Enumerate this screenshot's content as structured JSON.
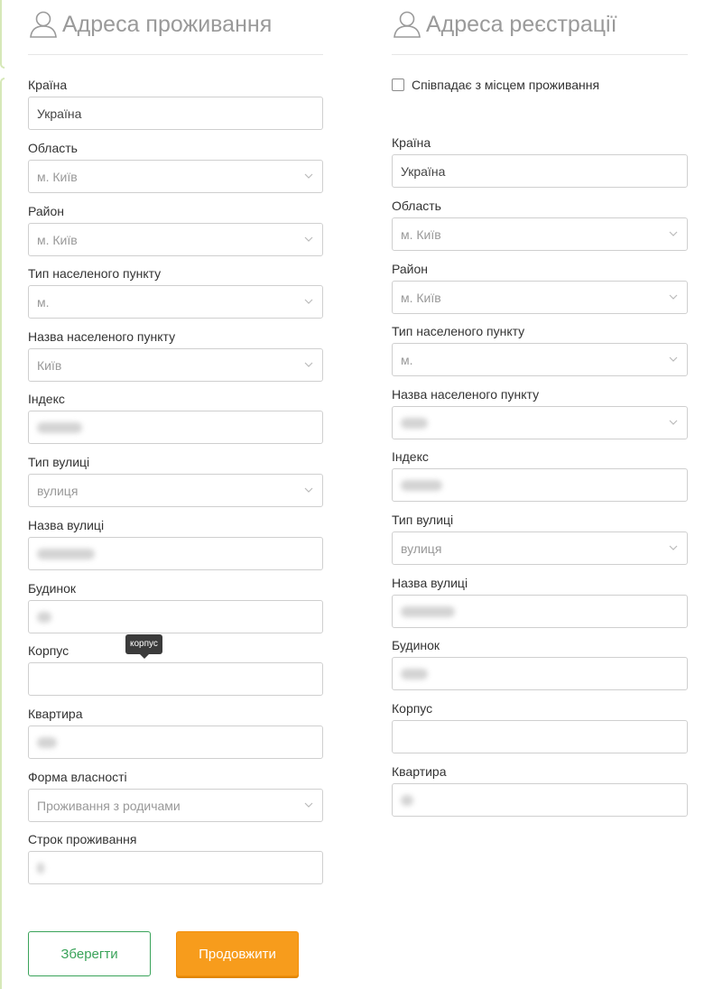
{
  "left_section": {
    "title": "Адреса проживання",
    "fields": [
      {
        "label": "Країна",
        "value": "Україна",
        "type": "input"
      },
      {
        "label": "Область",
        "value": "м. Київ",
        "type": "select"
      },
      {
        "label": "Район",
        "value": "м. Київ",
        "type": "select"
      },
      {
        "label": "Тип населеного пункту",
        "value": "м.",
        "type": "select"
      },
      {
        "label": "Назва населеного пункту",
        "value": "Київ",
        "type": "select"
      },
      {
        "label": "Індекс",
        "value": "",
        "type": "input-blurred"
      },
      {
        "label": "Тип вулиці",
        "value": "вулиця",
        "type": "select"
      },
      {
        "label": "Назва вулиці",
        "value": "",
        "type": "input-blurred"
      },
      {
        "label": "Будинок",
        "value": "",
        "type": "input-blurred"
      },
      {
        "label": "Корпус",
        "value": "",
        "type": "input"
      },
      {
        "label": "Квартира",
        "value": "",
        "type": "input-blurred"
      },
      {
        "label": "Форма власності",
        "value": "Проживання з родичами",
        "type": "select"
      },
      {
        "label": "Строк проживання",
        "value": "",
        "type": "input-blurred"
      }
    ],
    "tooltip": "корпус"
  },
  "right_section": {
    "title": "Адреса реєстрації",
    "same_as_residence_label": "Співпадає з місцем проживання",
    "fields": [
      {
        "label": "Країна",
        "value": "Україна",
        "type": "input"
      },
      {
        "label": "Область",
        "value": "м. Київ",
        "type": "select"
      },
      {
        "label": "Район",
        "value": "м. Київ",
        "type": "select"
      },
      {
        "label": "Тип населеного пункту",
        "value": "м.",
        "type": "select"
      },
      {
        "label": "Назва населеного пункту",
        "value": "",
        "type": "select-blurred"
      },
      {
        "label": "Індекс",
        "value": "",
        "type": "input-blurred"
      },
      {
        "label": "Тип вулиці",
        "value": "вулиця",
        "type": "select"
      },
      {
        "label": "Назва вулиці",
        "value": "",
        "type": "input-blurred"
      },
      {
        "label": "Будинок",
        "value": "",
        "type": "input-blurred"
      },
      {
        "label": "Корпус",
        "value": "",
        "type": "input"
      },
      {
        "label": "Квартира",
        "value": "",
        "type": "input-blurred"
      }
    ]
  },
  "buttons": {
    "save_label": "Зберегти",
    "continue_label": "Продовжити"
  },
  "colors": {
    "save_green": "#3aa35a",
    "continue_orange": "#f79c1c",
    "side_bar": "#d6e8b8"
  },
  "icons": {
    "section_icon": "user-icon",
    "select_icon": "chevron-down-icon"
  }
}
